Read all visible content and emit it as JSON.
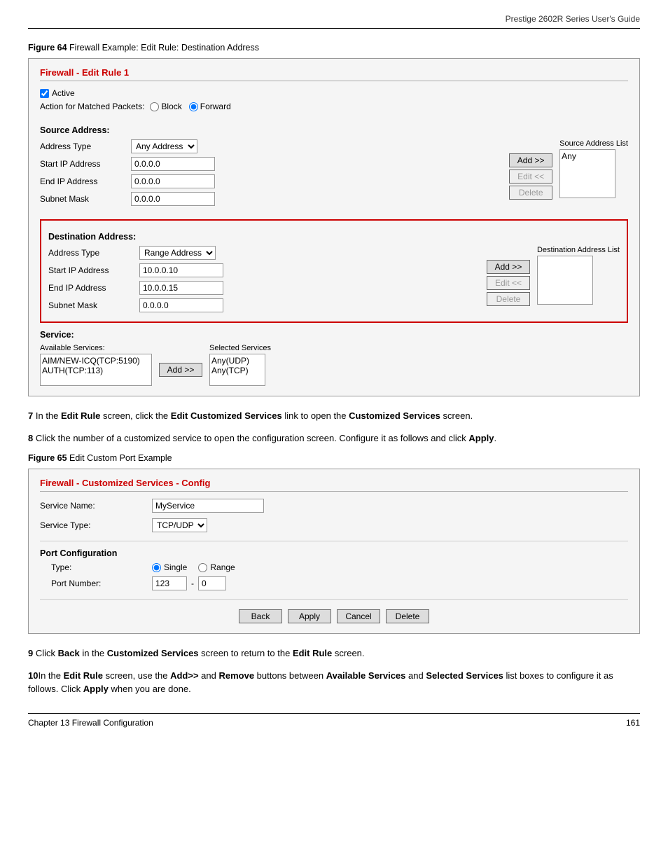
{
  "header": {
    "title": "Prestige 2602R Series User's Guide"
  },
  "figure64": {
    "caption_bold": "Figure 64",
    "caption_text": "   Firewall Example: Edit Rule: Destination Address",
    "ui_title": "Firewall - Edit Rule 1",
    "active_label": "Active",
    "action_label": "Action for Matched Packets:",
    "block_label": "Block",
    "forward_label": "Forward",
    "source_section_label": "Source Address:",
    "source_address_list_label": "Source Address List",
    "address_type_label": "Address Type",
    "start_ip_label": "Start IP Address",
    "end_ip_label": "End IP Address",
    "subnet_label": "Subnet Mask",
    "source_address_type": "Any Address",
    "source_start_ip": "0.0.0.0",
    "source_end_ip": "0.0.0.0",
    "source_subnet": "0.0.0.0",
    "source_list_item": "Any",
    "dest_section_label": "Destination Address:",
    "dest_address_list_label": "Destination Address List",
    "dest_address_type": "Range Address",
    "dest_start_ip": "10.0.0.10",
    "dest_end_ip": "10.0.0.15",
    "dest_subnet": "0.0.0.0",
    "add_btn": "Add >>",
    "edit_btn": "Edit <<",
    "delete_btn": "Delete",
    "service_label": "Service:",
    "available_services_label": "Available Services:",
    "selected_services_label": "Selected Services",
    "service_items": [
      "AIM/NEW-ICQ(TCP:5190)",
      "AUTH(TCP:113)"
    ],
    "selected_service_items": [
      "Any(UDP)",
      "Any(TCP)"
    ]
  },
  "step7": {
    "number": "7",
    "text_parts": [
      "In the ",
      "Edit Rule",
      " screen, click the ",
      "Edit Customized Services",
      " link to open the ",
      "Customized Services",
      " screen."
    ]
  },
  "step8": {
    "number": "8",
    "text_parts": [
      "Click the number of a customized service to open the configuration screen. Configure it as follows and click ",
      "Apply",
      "."
    ]
  },
  "figure65": {
    "caption_bold": "Figure 65",
    "caption_text": "   Edit Custom Port Example",
    "ui_title": "Firewall - Customized Services - Config",
    "service_name_label": "Service Name:",
    "service_name_value": "MyService",
    "service_type_label": "Service Type:",
    "service_type_value": "TCP/UDP",
    "port_config_label": "Port Configuration",
    "type_label": "Type:",
    "single_label": "Single",
    "range_label": "Range",
    "port_number_label": "Port Number:",
    "port_start": "123",
    "port_separator": "-",
    "port_end": "0",
    "back_btn": "Back",
    "apply_btn": "Apply",
    "cancel_btn": "Cancel",
    "delete_btn": "Delete"
  },
  "step9": {
    "number": "9",
    "text_parts": [
      "Click ",
      "Back",
      " in the ",
      "Customized Services",
      " screen to return to the ",
      "Edit Rule",
      " screen."
    ]
  },
  "step10": {
    "number": "10",
    "text_parts": [
      "In the ",
      "Edit Rule",
      " screen, use the ",
      "Add>>",
      " and ",
      "Remove",
      " buttons between ",
      "Available Services",
      " and ",
      "Selected Services",
      " list boxes to configure it as follows. Click ",
      "Apply",
      " when you are done."
    ]
  },
  "footer": {
    "left": "Chapter 13 Firewall Configuration",
    "right": "161"
  }
}
